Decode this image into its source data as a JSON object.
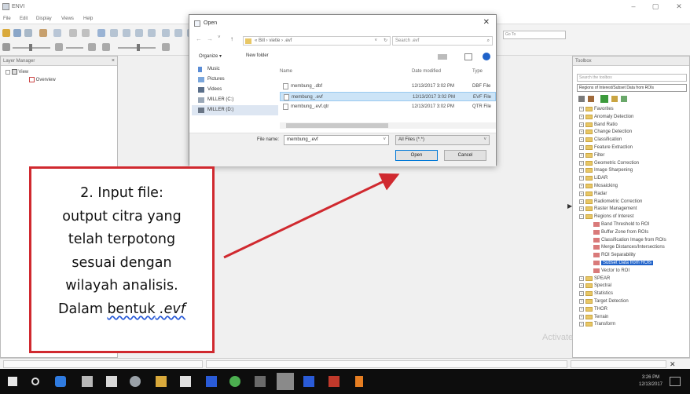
{
  "window": {
    "title": "ENVI",
    "buttons": [
      "–",
      "▢",
      "✕"
    ]
  },
  "menu": [
    "File",
    "Edit",
    "Display",
    "Views",
    "Help"
  ],
  "toolbar": {
    "goto_placeholder": "Go To"
  },
  "layer_manager": {
    "title": "Layer Manager",
    "close": "×",
    "tree": [
      {
        "label": "View"
      },
      {
        "label": "Overview"
      }
    ]
  },
  "toolbox": {
    "title": "Toolbox",
    "search_placeholder": "Search the toolbox",
    "selected_task": "Regions of Interest/Subset Data from ROIs",
    "items": [
      {
        "label": "Favorites",
        "type": "folder"
      },
      {
        "label": "Anomaly Detection",
        "type": "folder"
      },
      {
        "label": "Band Ratio",
        "type": "folder"
      },
      {
        "label": "Change Detection",
        "type": "folder"
      },
      {
        "label": "Classification",
        "type": "folder"
      },
      {
        "label": "Feature Extraction",
        "type": "folder"
      },
      {
        "label": "Filter",
        "type": "folder"
      },
      {
        "label": "Geometric Correction",
        "type": "folder"
      },
      {
        "label": "Image Sharpening",
        "type": "folder"
      },
      {
        "label": "LiDAR",
        "type": "folder"
      },
      {
        "label": "Mosaicking",
        "type": "folder"
      },
      {
        "label": "Radar",
        "type": "folder"
      },
      {
        "label": "Radiometric Correction",
        "type": "folder"
      },
      {
        "label": "Raster Management",
        "type": "folder"
      },
      {
        "label": "Regions of Interest",
        "type": "folder-open"
      },
      {
        "label": "Band Threshold to ROI",
        "type": "tool"
      },
      {
        "label": "Buffer Zone from ROIs",
        "type": "tool"
      },
      {
        "label": "Classification Image from ROIs",
        "type": "tool"
      },
      {
        "label": "Merge Distances/Intersections",
        "type": "tool"
      },
      {
        "label": "ROI Separability",
        "type": "tool"
      },
      {
        "label": "Subset Data from ROIs",
        "type": "tool",
        "selected": true
      },
      {
        "label": "Vector to ROI",
        "type": "tool"
      },
      {
        "label": "SPEAR",
        "type": "folder"
      },
      {
        "label": "Spectral",
        "type": "folder"
      },
      {
        "label": "Statistics",
        "type": "folder"
      },
      {
        "label": "Target Detection",
        "type": "folder"
      },
      {
        "label": "THOR",
        "type": "folder"
      },
      {
        "label": "Terrain",
        "type": "folder"
      },
      {
        "label": "Transform",
        "type": "folder"
      }
    ]
  },
  "watermark": "Activate",
  "dialog": {
    "title": "Open",
    "close": "✕",
    "address": "« Bill › vietle › .evf",
    "search_placeholder": "Search .evf",
    "organize": "Organize ▾",
    "new_folder": "New folder",
    "nav": [
      {
        "label": "Music"
      },
      {
        "label": "Pictures"
      },
      {
        "label": "Videos"
      },
      {
        "label": "MILLER (C:)"
      },
      {
        "label": "MILLER (D:)"
      }
    ],
    "columns": [
      "Name",
      "Date modified",
      "Type"
    ],
    "files": [
      {
        "name": "membung_.dbf",
        "date": "12/13/2017 3:02 PM",
        "type": "DBF File"
      },
      {
        "name": "membung_.evf",
        "date": "12/13/2017 3:02 PM",
        "type": "EVF File",
        "selected": true
      },
      {
        "name": "membung_.evf.qtr",
        "date": "12/13/2017 3:02 PM",
        "type": "QTR File"
      }
    ],
    "file_name_label": "File name:",
    "file_name_value": "membung_.evf",
    "file_type_value": "All Files (*.*)",
    "open_label": "Open",
    "cancel_label": "Cancel"
  },
  "callout": {
    "lines": [
      "2. Input file:",
      "output citra yang",
      "telah terpotong",
      "sesuai dengan",
      "wilayah analisis."
    ],
    "last_line_prefix": "Dalam ",
    "last_line_word": "bentuk",
    "last_line_suffix": " .evf"
  },
  "taskbar": {
    "clock_time": "3:26 PM",
    "clock_date": "12/13/2017"
  },
  "colors": {
    "callout_border": "#d0292f",
    "arrow": "#d0292f",
    "selection": "#1f62c9"
  }
}
